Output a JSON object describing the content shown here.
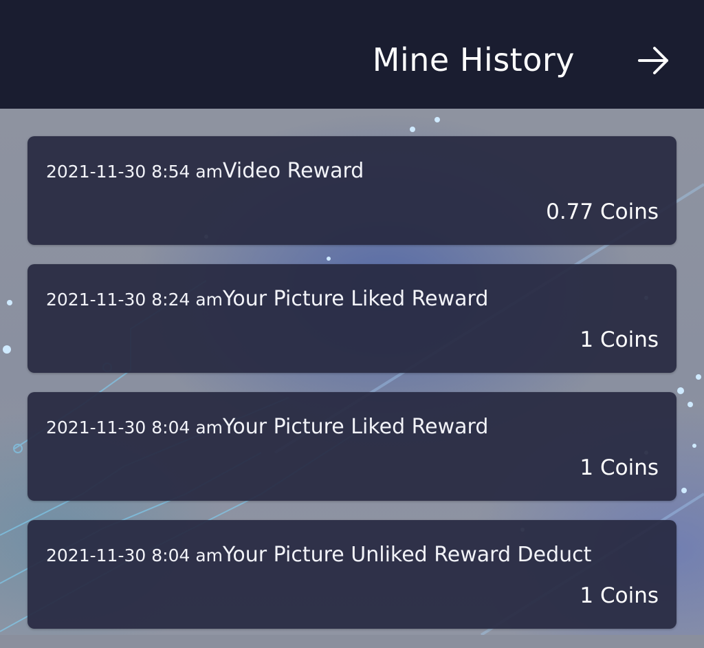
{
  "header": {
    "title": "Mine History",
    "nav_icon": "arrow-right-icon"
  },
  "history": [
    {
      "time": "2021-11-30 8:54 am",
      "type": "Video Reward",
      "amount": "0.77 Coins"
    },
    {
      "time": "2021-11-30 8:24 am",
      "type": "Your Picture Liked Reward",
      "amount": "1 Coins"
    },
    {
      "time": "2021-11-30 8:04 am",
      "type": "Your Picture Liked Reward",
      "amount": "1 Coins"
    },
    {
      "time": "2021-11-30 8:04 am",
      "type": "Your Picture Unliked Reward Deduct",
      "amount": "1 Coins"
    }
  ],
  "colors": {
    "header_bg": "#1a1d30",
    "card_bg": "#282a42",
    "text": "#ffffff"
  }
}
